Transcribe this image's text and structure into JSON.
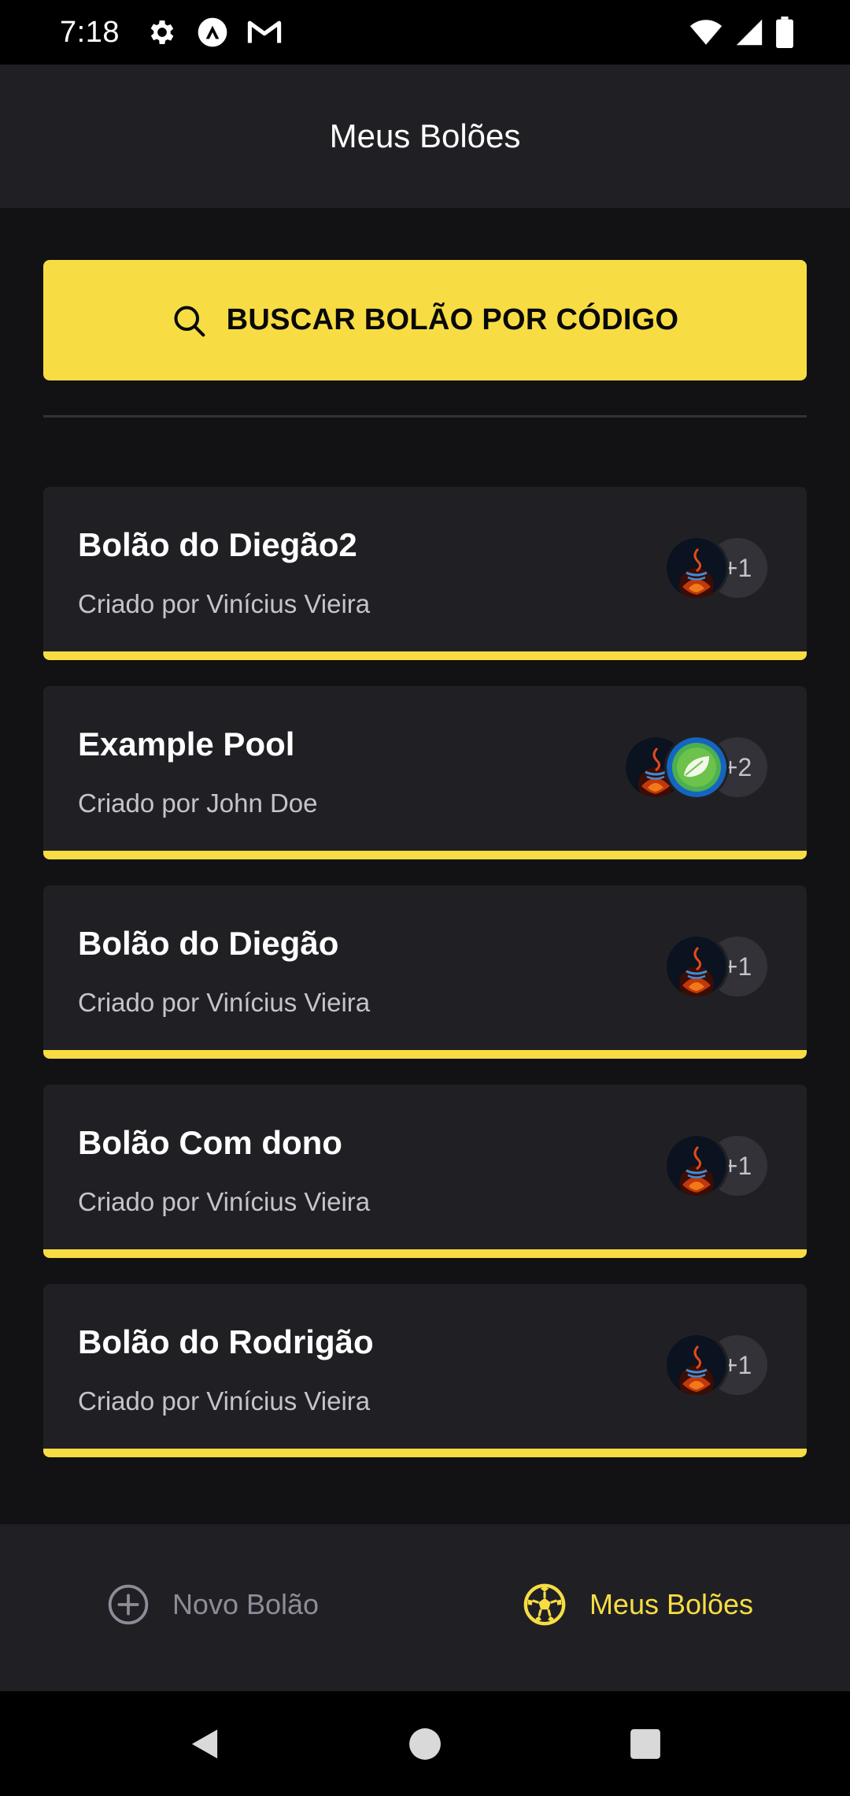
{
  "status_bar": {
    "time": "7:18",
    "left_icons": [
      "settings-icon",
      "app-notification-icon",
      "gmail-icon"
    ],
    "right_icons": [
      "wifi-icon",
      "signal-icon",
      "battery-icon"
    ]
  },
  "header": {
    "title": "Meus Bolões"
  },
  "search": {
    "label": "BUSCAR BOLÃO POR CÓDIGO",
    "icon": "search-icon"
  },
  "pools": [
    {
      "title": "Bolão do Diegão2",
      "owner": "Criado por Vinícius Vieira",
      "avatars": [
        "java"
      ],
      "more": "+1"
    },
    {
      "title": "Example Pool",
      "owner": "Criado por John Doe",
      "avatars": [
        "java",
        "spring"
      ],
      "more": "+2"
    },
    {
      "title": "Bolão do Diegão",
      "owner": "Criado por Vinícius Vieira",
      "avatars": [
        "java"
      ],
      "more": "+1"
    },
    {
      "title": "Bolão Com dono",
      "owner": "Criado por Vinícius Vieira",
      "avatars": [
        "java"
      ],
      "more": "+1"
    },
    {
      "title": "Bolão do Rodrigão",
      "owner": "Criado por Vinícius Vieira",
      "avatars": [
        "java"
      ],
      "more": "+1"
    }
  ],
  "tabs": {
    "new_pool": {
      "label": "Novo Bolão",
      "icon": "plus-circle-icon",
      "active": false
    },
    "my_pools": {
      "label": "Meus Bolões",
      "icon": "soccer-ball-icon",
      "active": true
    }
  },
  "colors": {
    "accent": "#F7DD43",
    "background": "#121214",
    "surface": "#202024",
    "muted_text": "#C4C4CC",
    "inactive_tab": "#8D8D99"
  },
  "nav_bar": {
    "buttons": [
      "back-icon",
      "home-icon",
      "recents-icon"
    ]
  }
}
